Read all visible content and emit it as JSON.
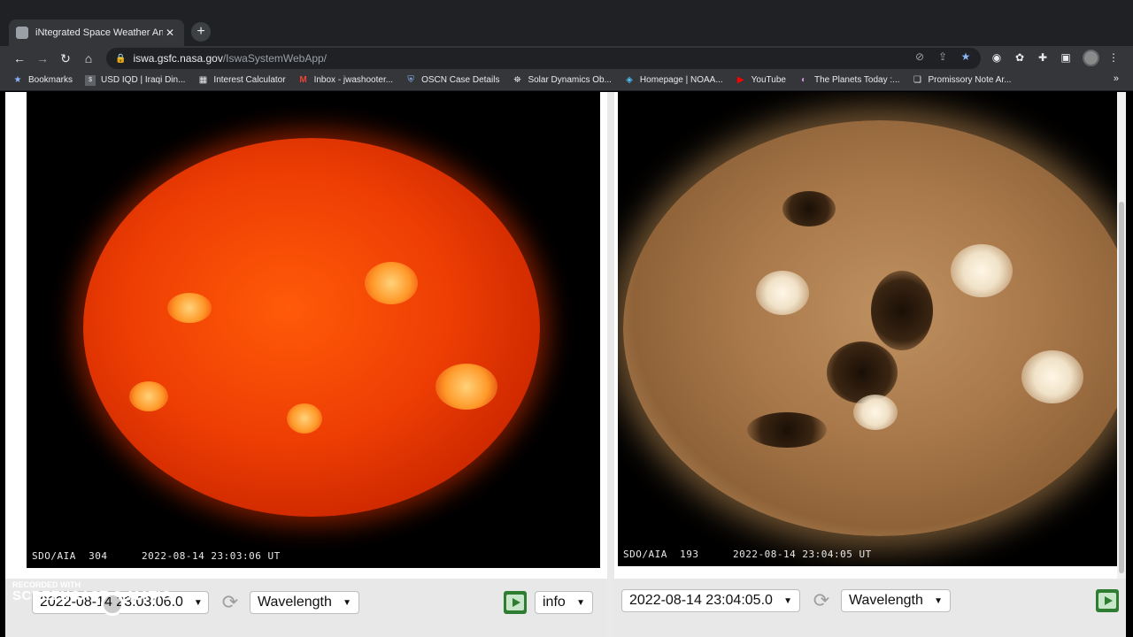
{
  "browser": {
    "tab_title": "iNtegrated Space Weather Analy",
    "new_tab": "+",
    "url_host": "iswa.gsfc.nasa.gov",
    "url_path": "/IswaSystemWebApp/"
  },
  "bookmarks": [
    {
      "label": "Bookmarks",
      "icon": "star-icon"
    },
    {
      "label": "USD IQD | Iraqi Din...",
      "icon": "currency-icon"
    },
    {
      "label": "Interest Calculator",
      "icon": "calculator-icon"
    },
    {
      "label": "Inbox - jwashooter...",
      "icon": "gmail-icon"
    },
    {
      "label": "OSCN Case Details",
      "icon": "shield-icon"
    },
    {
      "label": "Solar Dynamics Ob...",
      "icon": "satellite-icon"
    },
    {
      "label": "Homepage | NOAA...",
      "icon": "noaa-icon"
    },
    {
      "label": "YouTube",
      "icon": "youtube-icon"
    },
    {
      "label": "The Planets Today :...",
      "icon": "planet-icon"
    },
    {
      "label": "Promissory Note Ar...",
      "icon": "document-icon"
    }
  ],
  "bookmarks_more": "»",
  "panels": {
    "left": {
      "instrument": "SDO/AIA  304",
      "timestamp": "2022-08-14 23:03:06 UT",
      "time_select": "2022-08-14 23:03:06.0",
      "wavelength_select": "Wavelength",
      "info_select": "info"
    },
    "right": {
      "instrument": "SDO/AIA  193",
      "timestamp": "2022-08-14 23:04:05 UT",
      "time_select": "2022-08-14 23:04:05.0",
      "wavelength_select": "Wavelength"
    }
  },
  "watermark": {
    "line1": "RECORDED WITH",
    "line2": "SCREENCAST-O-MATIC"
  },
  "colors": {
    "aia304": "#ee3e04",
    "aia193": "#a8784a"
  }
}
